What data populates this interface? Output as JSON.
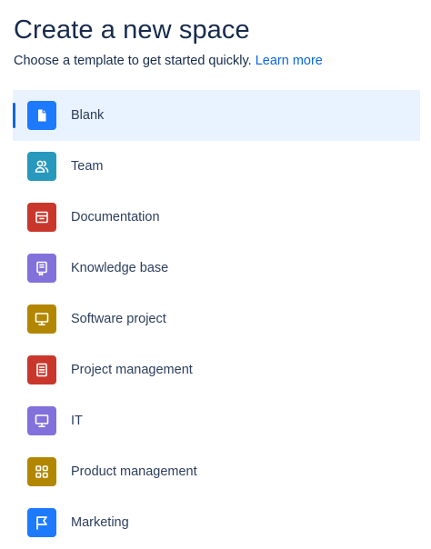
{
  "header": {
    "title": "Create a new space",
    "subtitle": "Choose a template to get started quickly.",
    "learn_more": "Learn more"
  },
  "templates": [
    {
      "label": "Blank",
      "icon": "blank-page-icon",
      "color": "#1d7afc",
      "selected": true
    },
    {
      "label": "Team",
      "icon": "people-icon",
      "color": "#2898bd",
      "selected": false
    },
    {
      "label": "Documentation",
      "icon": "archive-icon",
      "color": "#c9372c",
      "selected": false
    },
    {
      "label": "Knowledge base",
      "icon": "book-icon",
      "color": "#8270db",
      "selected": false
    },
    {
      "label": "Software project",
      "icon": "monitor-icon",
      "color": "#b38600",
      "selected": false
    },
    {
      "label": "Project management",
      "icon": "document-list-icon",
      "color": "#c9372c",
      "selected": false
    },
    {
      "label": "IT",
      "icon": "monitor-icon",
      "color": "#8270db",
      "selected": false
    },
    {
      "label": "Product management",
      "icon": "grid-icon",
      "color": "#b38600",
      "selected": false
    },
    {
      "label": "Marketing",
      "icon": "flag-icon",
      "color": "#1d7afc",
      "selected": false
    }
  ]
}
